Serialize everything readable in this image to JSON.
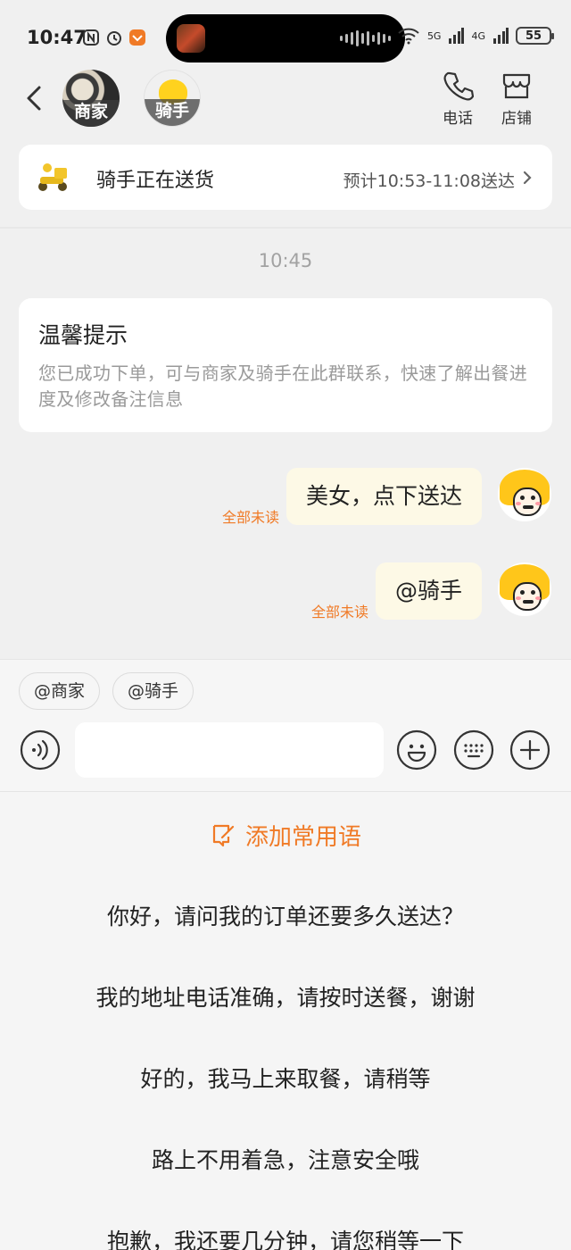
{
  "status_bar": {
    "time": "10:47",
    "network_1": "5G",
    "network_2": "4G",
    "battery": "55"
  },
  "header": {
    "shop_label": "商家",
    "rider_label": "骑手",
    "phone_label": "电话",
    "store_label": "店铺"
  },
  "delivery": {
    "title": "骑手正在送货",
    "eta": "预计10:53-11:08送达"
  },
  "chat": {
    "time": "10:45",
    "notice_title": "温馨提示",
    "notice_body": "您已成功下单，可与商家及骑手在此群联系，快速了解出餐进度及修改备注信息",
    "messages": [
      {
        "text": "美女，点下送达",
        "status": "全部未读"
      },
      {
        "text": "@骑手",
        "status": "全部未读"
      }
    ]
  },
  "input": {
    "chips": [
      "@商家",
      "@骑手"
    ],
    "placeholder": ""
  },
  "phrases": {
    "add_label": "添加常用语",
    "items": [
      "你好，请问我的订单还要多久送达？",
      "我的地址电话准确，请按时送餐，谢谢",
      "好的，我马上来取餐，请稍等",
      "路上不用着急，注意安全哦",
      "抱歉，我还要几分钟，请您稍等一下"
    ]
  },
  "colors": {
    "accent": "#f07a26",
    "bubble": "#fdf9e6",
    "background": "#f0f0f0"
  }
}
